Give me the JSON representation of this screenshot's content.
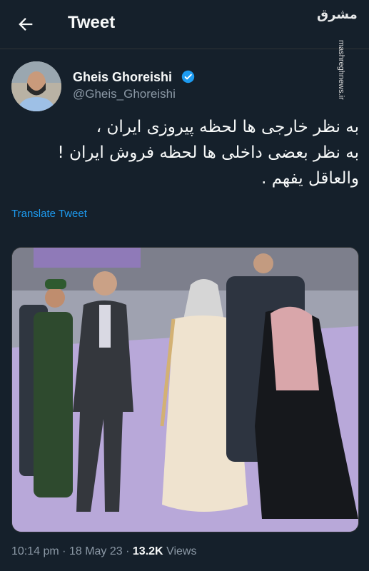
{
  "header": {
    "title": "Tweet",
    "watermark_logo": "مشرق",
    "watermark_url": "mashreghnews.ir"
  },
  "author": {
    "name": "Gheis Ghoreishi",
    "handle": "@Gheis_Ghoreishi",
    "verified": true
  },
  "tweet": {
    "lines": [
      "به نظر خارجی ها لحظه پیروزی ایران ،",
      "به نظر بعضی داخلی ها لحظه فروش ایران !",
      "والعاقل یفهم ."
    ],
    "translate_label": "Translate Tweet"
  },
  "meta": {
    "time": "10:14 pm",
    "date": "18 May 23",
    "separator": "·",
    "views_count": "13.2K",
    "views_label": "Views"
  },
  "colors": {
    "background": "#15202b",
    "accent": "#1d9bf0",
    "secondary_text": "#8b98a5"
  },
  "icons": {
    "back": "arrow-left-icon",
    "verified": "verified-badge-icon"
  }
}
